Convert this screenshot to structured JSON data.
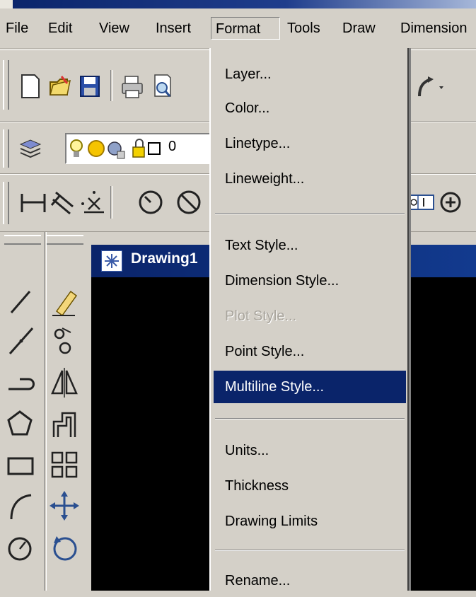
{
  "menubar": {
    "items": [
      {
        "label": "File"
      },
      {
        "label": "Edit"
      },
      {
        "label": "View"
      },
      {
        "label": "Insert"
      },
      {
        "label": "Format"
      },
      {
        "label": "Tools"
      },
      {
        "label": "Draw"
      },
      {
        "label": "Dimension"
      }
    ],
    "open_menu": "Format"
  },
  "format_menu": {
    "items": [
      {
        "label": "Layer..."
      },
      {
        "label": "Color..."
      },
      {
        "label": "Linetype..."
      },
      {
        "label": "Lineweight..."
      },
      {
        "label": "Text Style..."
      },
      {
        "label": "Dimension Style..."
      },
      {
        "label": "Plot Style...",
        "enabled": false
      },
      {
        "label": "Point Style..."
      },
      {
        "label": "Multiline Style...",
        "selected": true
      },
      {
        "label": "Units..."
      },
      {
        "label": "Thickness"
      },
      {
        "label": "Drawing Limits"
      },
      {
        "label": "Rename..."
      }
    ]
  },
  "layer_toolbar": {
    "current_layer": "0"
  },
  "drawing_window": {
    "title": "Drawing1"
  },
  "colors": {
    "menu_bg": "#d4d0c8",
    "highlight": "#0a246a",
    "highlight_text": "#ffffff",
    "disabled_text": "#a8a49c",
    "canvas": "#000000"
  },
  "icons": {
    "standard_toolbar": [
      "new-icon",
      "open-icon",
      "save-icon",
      "print-icon",
      "print-preview-icon",
      "undo-icon"
    ],
    "layer_toolbar": [
      "layer-manager-icon",
      "lightbulb-icon",
      "sun-icon",
      "layer-lock-icon",
      "color-swatch-icon"
    ],
    "dimension_toolbar": [
      "linear-dimension-icon",
      "aligned-dimension-icon",
      "ordinate-dimension-icon",
      "radius-dimension-icon",
      "diameter-dimension-icon",
      "tolerance-icon",
      "center-mark-icon"
    ],
    "draw_toolbar": [
      "line-icon",
      "construction-line-icon",
      "polyline-icon",
      "polygon-icon",
      "rectangle-icon",
      "arc-icon",
      "circle-icon"
    ],
    "modify_toolbar": [
      "erase-icon",
      "copy-icon",
      "mirror-icon",
      "offset-icon",
      "array-icon",
      "move-icon",
      "rotate-icon"
    ]
  }
}
